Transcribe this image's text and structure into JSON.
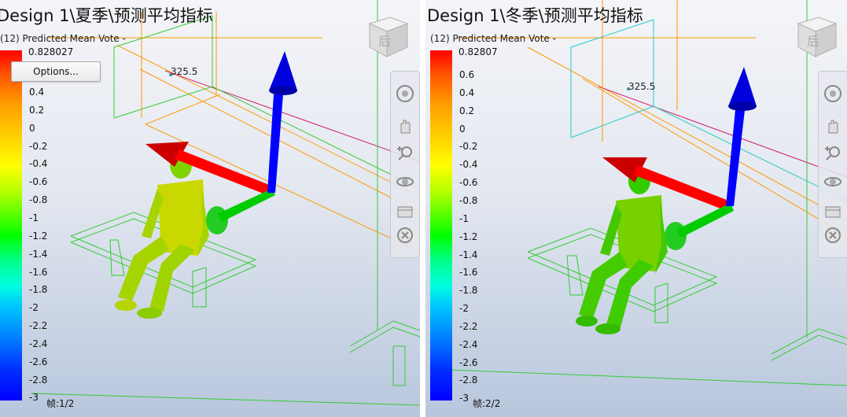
{
  "panels": [
    {
      "title": "Design 1\\夏季\\预测平均指标",
      "legend_title": "(12) Predicted Mean Vote -",
      "max_label": "0.828027",
      "ticks": [
        "0.4",
        "0.2",
        "0",
        "-0.2",
        "-0.4",
        "-0.6",
        "-0.8",
        "-1",
        "-1.2",
        "-1.4",
        "-1.6",
        "-1.8",
        "-2",
        "-2.2",
        "-2.4",
        "-2.6",
        "-2.8",
        "-3"
      ],
      "frame": "帧:1/2",
      "dimension": "325.5",
      "options_label": "Options...",
      "viewcube_label": "后"
    },
    {
      "title": "Design 1\\冬季\\预测平均指标",
      "legend_title": "(12) Predicted Mean Vote -",
      "max_label": "0.82807",
      "ticks": [
        "0.6",
        "0.4",
        "0.2",
        "0",
        "-0.2",
        "-0.4",
        "-0.6",
        "-0.8",
        "-1",
        "-1.2",
        "-1.4",
        "-1.6",
        "-1.8",
        "-2",
        "-2.2",
        "-2.4",
        "-2.6",
        "-2.8",
        "-3"
      ],
      "frame": "帧:2/2",
      "dimension": "325.5",
      "viewcube_label": "后"
    }
  ],
  "colors": {
    "axis_x": "#ff0000",
    "axis_y": "#00cc00",
    "axis_z": "#0000ff",
    "wire_green": "#33cc33",
    "wire_orange": "#ff9900",
    "wire_cyan": "#22cccc"
  },
  "icons": [
    "viewcube-icon",
    "steering-wheel-icon",
    "pan-icon",
    "zoom-icon",
    "orbit-icon",
    "show-motion-icon",
    "rewind-icon"
  ]
}
